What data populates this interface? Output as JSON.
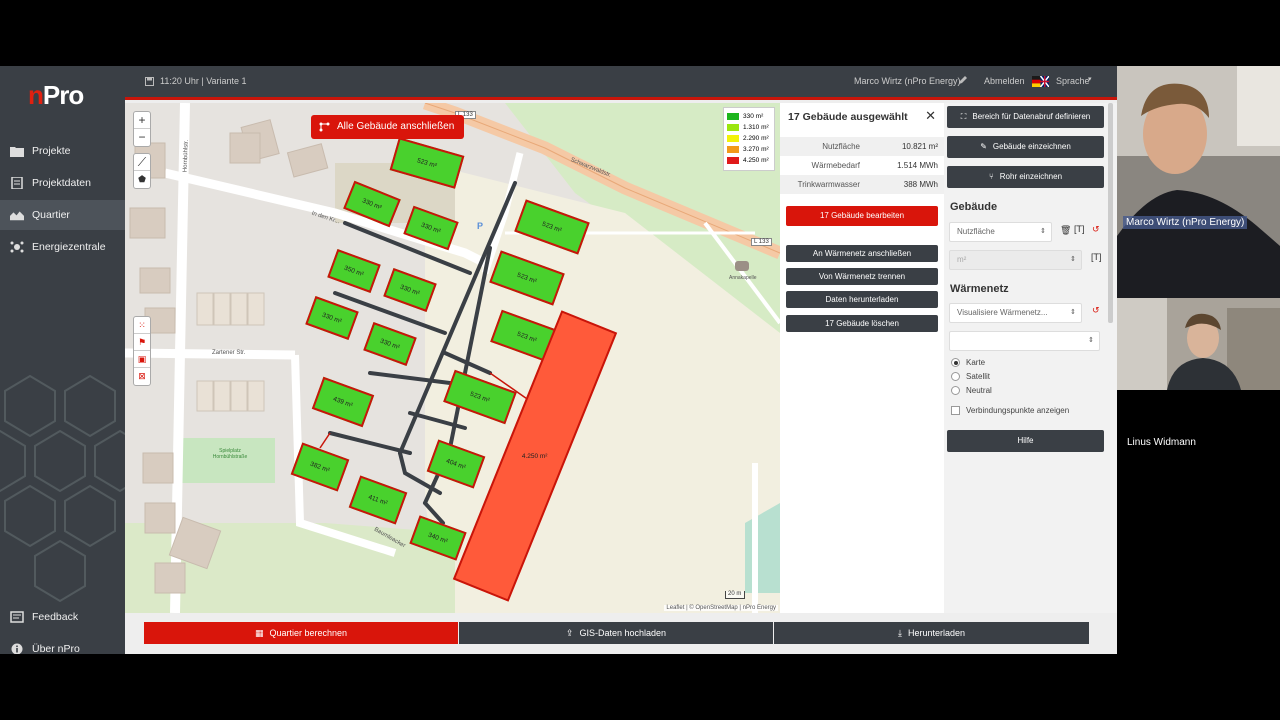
{
  "app": {
    "logo_n": "n",
    "logo_rest": "Pro",
    "header": {
      "time_variant": "11:20 Uhr | Variante 1",
      "user": "Marco Wirtz (nPro Energy)",
      "logout": "Abmelden",
      "language": "Sprache"
    },
    "sidebar": {
      "items": [
        {
          "label": "Projekte",
          "icon": "folder-icon"
        },
        {
          "label": "Projektdaten",
          "icon": "document-icon"
        },
        {
          "label": "Quartier",
          "icon": "houses-icon"
        },
        {
          "label": "Energiezentrale",
          "icon": "network-icon"
        }
      ],
      "feedback": "Feedback",
      "about": "Über nPro"
    }
  },
  "map": {
    "connect_all_label": "Alle Gebäude anschließen",
    "zoom_in": "+",
    "zoom_out": "−",
    "legend": [
      {
        "label": "330 m²",
        "color": "#1db51d"
      },
      {
        "label": "1.310 m²",
        "color": "#9be60f"
      },
      {
        "label": "2.290 m²",
        "color": "#f2f20a"
      },
      {
        "label": "3.270 m²",
        "color": "#f29a1a"
      },
      {
        "label": "4.250 m²",
        "color": "#e01a1a"
      }
    ],
    "buildings": [
      "523 m²",
      "330 m²",
      "330 m²",
      "523 m²",
      "350 m²",
      "330 m²",
      "523 m²",
      "330 m²",
      "330 m²",
      "523 m²",
      "439 m²",
      "523 m²",
      "404 m²",
      "382 m²",
      "411 m²",
      "340 m²",
      "4.250 m²"
    ],
    "street_labels": [
      "Schwarzwaldstr.",
      "In den Kr...",
      "Zartener Str.",
      "Hornbühlstr.",
      "Baumleacker",
      "L 133",
      "L 133",
      "Annakapelle",
      "Spielplatz Hornbühlstraße"
    ],
    "parking": "P",
    "scale": "20 m",
    "attribution": "Leaflet | © OpenStreetMap | nPro Energy"
  },
  "info_panel": {
    "title": "17 Gebäude ausgewählt",
    "close": "✕",
    "rows": [
      {
        "key": "Nutzfläche",
        "value": "10.821 m²"
      },
      {
        "key": "Wärmebedarf",
        "value": "1.514 MWh"
      },
      {
        "key": "Trinkwarmwasser",
        "value": "388 MWh"
      }
    ],
    "edit_button": "17 Gebäude bearbeiten",
    "connect_button": "An Wärmenetz anschließen",
    "disconnect_button": "Von Wärmenetz trennen",
    "download_button": "Daten herunterladen",
    "delete_button": "17 Gebäude löschen"
  },
  "right_panel": {
    "define_area": "Bereich für Datenabruf definieren",
    "draw_building": "Gebäude einzeichnen",
    "draw_pipe": "Rohr einzeichnen",
    "buildings_heading": "Gebäude",
    "buildings_select": "Nutzfläche",
    "unit_select": "m²",
    "network_heading": "Wärmenetz",
    "network_select": "Visualisiere Wärmenetz...",
    "network_select2": "",
    "radio_options": [
      {
        "label": "Karte",
        "checked": true
      },
      {
        "label": "Satellit",
        "checked": false
      },
      {
        "label": "Neutral",
        "checked": false
      }
    ],
    "connection_points": "Verbindungspunkte anzeigen",
    "help": "Hilfe"
  },
  "bottom_bar": {
    "calculate": "Quartier berechnen",
    "upload_gis": "GIS-Daten hochladen",
    "download": "Herunterladen"
  },
  "video": {
    "participant1": "Marco Wirtz (nPro Energy)",
    "participant2": "Linus Widmann"
  }
}
